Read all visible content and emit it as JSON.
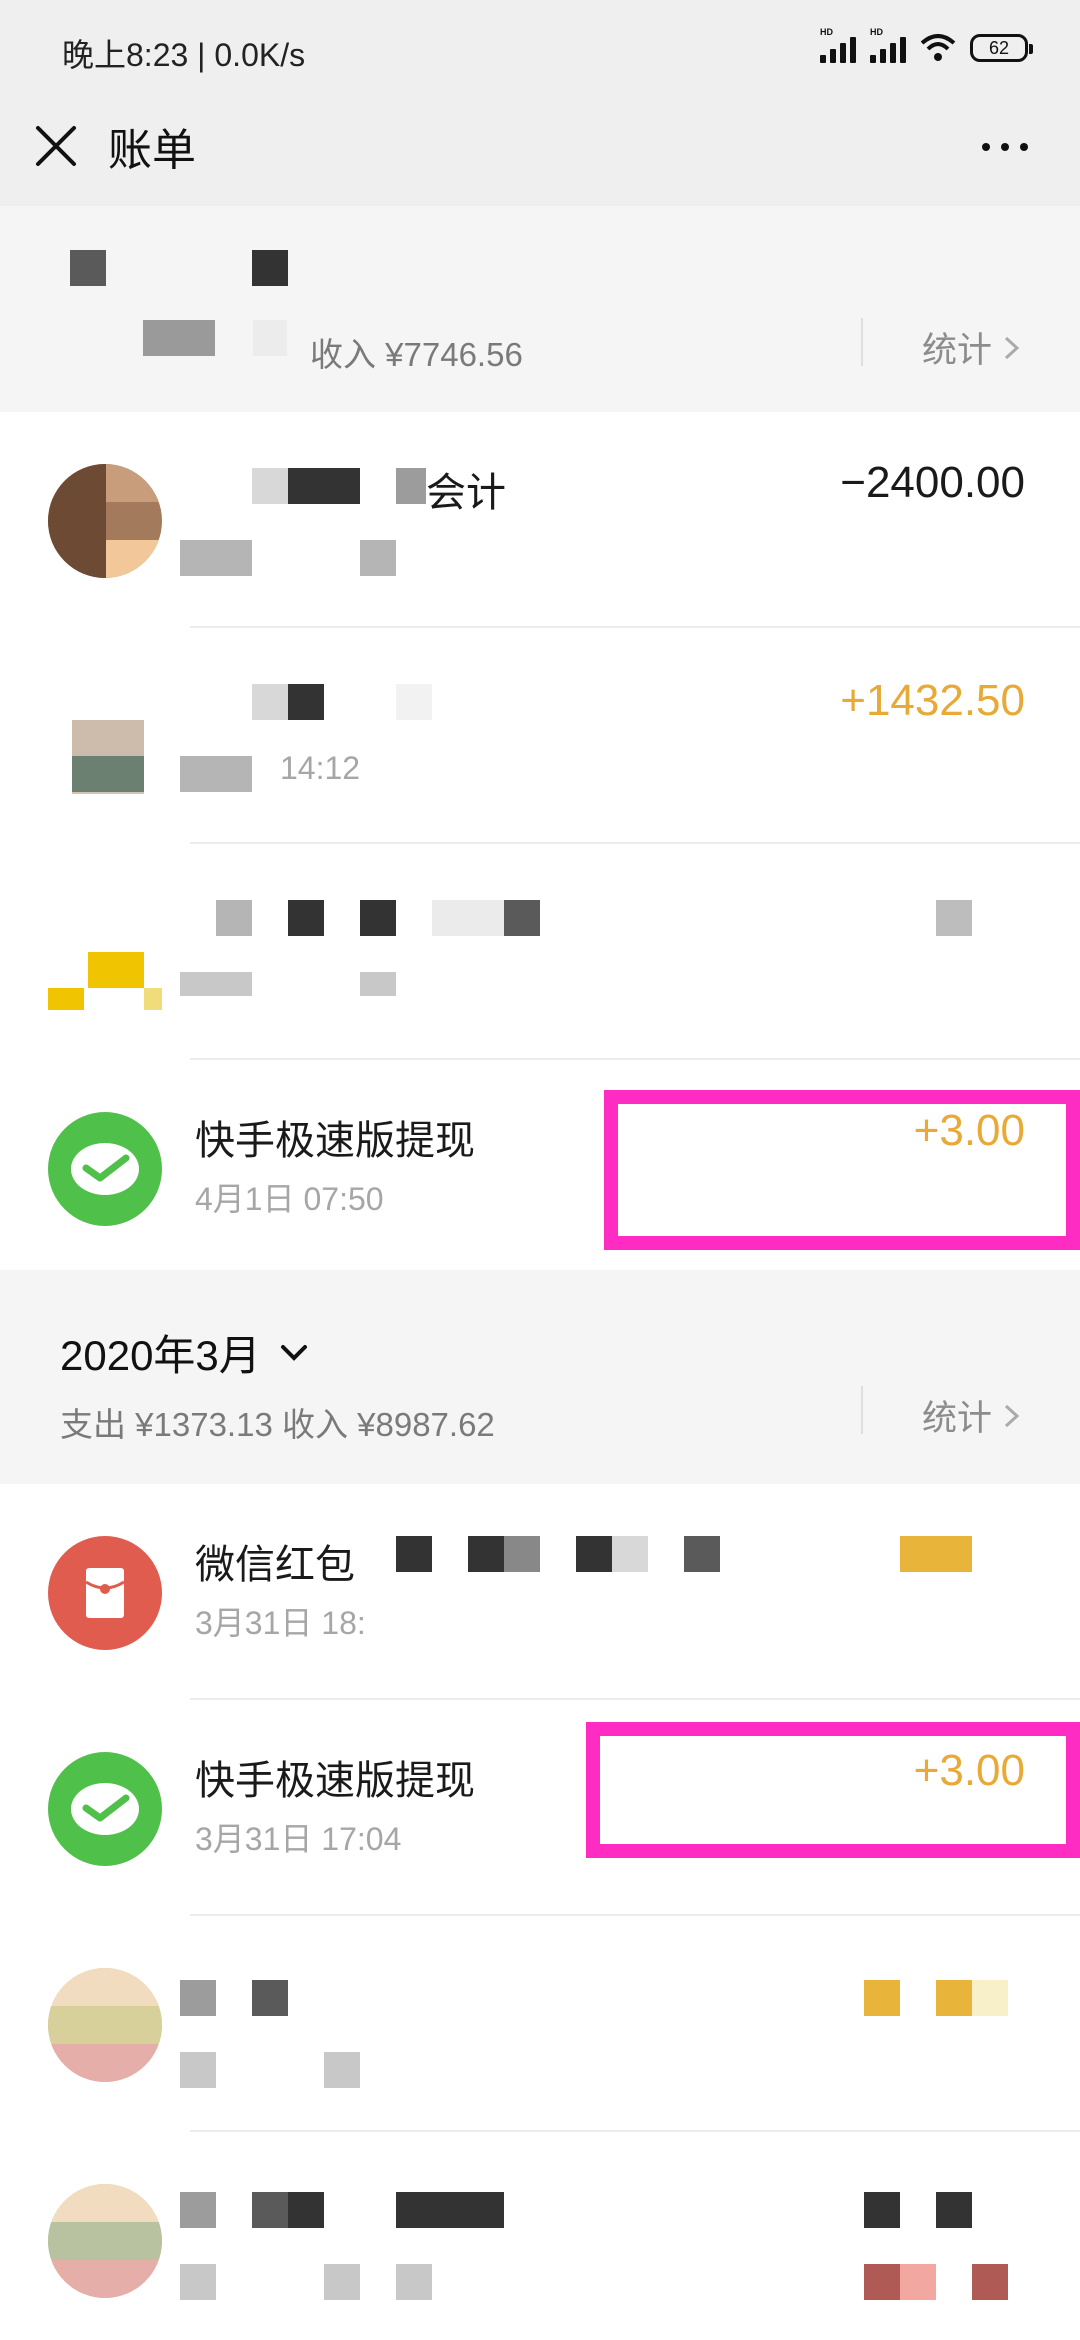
{
  "status_bar": {
    "time": "晚上8:23 | 0.0K/s",
    "battery": "62",
    "hd": "HD"
  },
  "title_bar": {
    "title": "账单",
    "close_icon": "close-icon",
    "more_icon": "more-icon"
  },
  "month_summary_top": {
    "summary": "收入 ¥7746.56",
    "stat_label": "统计"
  },
  "rows_top": [
    {
      "title": "会计",
      "time": "",
      "amount": "−2400.00"
    },
    {
      "title": "",
      "time": "14:12",
      "amount": "+1432.50"
    },
    {
      "title": "",
      "time": "",
      "amount": ""
    },
    {
      "title": "快手极速版提现",
      "time": "4月1日 07:50",
      "amount": "+3.00"
    }
  ],
  "month_header_march": {
    "title": "2020年3月",
    "summary": "支出 ¥1373.13 收入 ¥8987.62",
    "stat_label": "统计"
  },
  "rows_march": [
    {
      "title": "微信红包",
      "time": "3月31日 18:",
      "amount": ""
    },
    {
      "title": "快手极速版提现",
      "time": "3月31日 17:04",
      "amount": "+3.00"
    },
    {
      "title": "",
      "time": "",
      "amount": ""
    },
    {
      "title": "",
      "time": "",
      "amount": ""
    }
  ],
  "colors": {
    "income": "#e8a936",
    "highlight": "#ff2cc3",
    "wechat_green": "#4fc14b",
    "redpacket": "#e05c4f"
  }
}
